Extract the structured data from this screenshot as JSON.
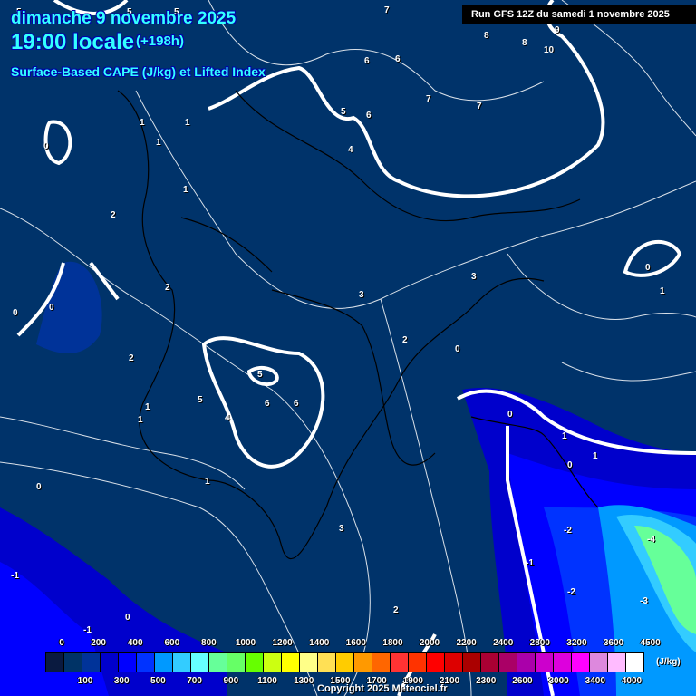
{
  "header": {
    "date": "dimanche 9 novembre 2025",
    "time": "19:00 locale",
    "lead": "(+198h)",
    "parameter": "Surface-Based CAPE (J/kg) et Lifted Index",
    "run": "Run GFS 12Z du samedi 1 novembre 2025"
  },
  "contour_labels": [
    "5",
    "5",
    "5",
    "7",
    "8",
    "10",
    "8",
    "9",
    "10",
    "6",
    "6",
    "7",
    "7",
    "5",
    "6",
    "4",
    "1",
    "1",
    "1",
    "0",
    "1",
    "2",
    "2",
    "3",
    "0",
    "0",
    "0",
    "2",
    "3",
    "2",
    "0",
    "5",
    "6",
    "6",
    "5",
    "4",
    "1",
    "1",
    "1",
    "0",
    "1",
    "0",
    "-1",
    "0",
    "1",
    "3",
    "1",
    "2",
    "-1",
    "-2",
    "-2",
    "-3",
    "-4",
    "-1",
    "0"
  ],
  "colorbar": {
    "unit": "(J/kg)",
    "top_labels": [
      "0",
      "200",
      "400",
      "600",
      "800",
      "1000",
      "1200",
      "1400",
      "1600",
      "1800",
      "2000",
      "2200",
      "2400",
      "2800",
      "3200",
      "3600",
      "4500"
    ],
    "bottom_labels": [
      "100",
      "300",
      "500",
      "700",
      "900",
      "1100",
      "1300",
      "1500",
      "1700",
      "1900",
      "2100",
      "2300",
      "2600",
      "3000",
      "3400",
      "4000"
    ],
    "colors": [
      "#0a1a40",
      "#003366",
      "#003399",
      "#0000cc",
      "#0000ff",
      "#0033ff",
      "#0099ff",
      "#33ccff",
      "#66ffff",
      "#66ff99",
      "#66ff66",
      "#66ff00",
      "#ccff11",
      "#ffff00",
      "#ffff88",
      "#ffe055",
      "#ffcc00",
      "#ff9900",
      "#ff6600",
      "#ff3333",
      "#ff3300",
      "#ff0000",
      "#dd0000",
      "#aa0000",
      "#aa0033",
      "#aa0066",
      "#aa00aa",
      "#cc00cc",
      "#dd00dd",
      "#ff00ff",
      "#dd88dd",
      "#ffbbff",
      "#ffffff"
    ]
  },
  "copyright": "Copyright 2025 Meteociel.fr"
}
